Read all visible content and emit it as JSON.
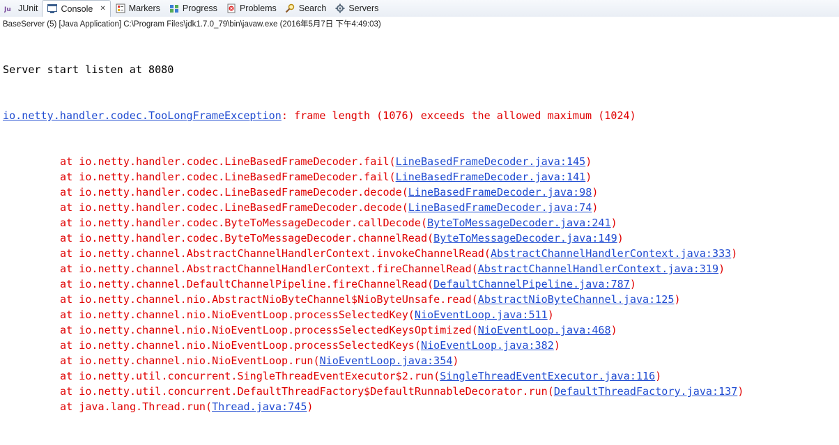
{
  "tabs": [
    {
      "label": "JUnit",
      "icon": "junit-icon"
    },
    {
      "label": "Console",
      "icon": "console-icon",
      "close": "✕"
    },
    {
      "label": "Markers",
      "icon": "markers-icon"
    },
    {
      "label": "Progress",
      "icon": "progress-icon"
    },
    {
      "label": "Problems",
      "icon": "problems-icon"
    },
    {
      "label": "Search",
      "icon": "search-icon"
    },
    {
      "label": "Servers",
      "icon": "servers-icon"
    }
  ],
  "info_line": "BaseServer (5) [Java Application] C:\\Program Files\\jdk1.7.0_79\\bin\\javaw.exe (2016年5月7日 下午4:49:03)",
  "console": {
    "first_line": "Server start listen at 8080",
    "exception": {
      "link": "io.netty.handler.codec.TooLongFrameException",
      "message": ": frame length (1076) exceeds the allowed maximum (1024)"
    },
    "stack": [
      {
        "method": "at io.netty.handler.codec.LineBasedFrameDecoder.fail(",
        "link": "LineBasedFrameDecoder.java:145"
      },
      {
        "method": "at io.netty.handler.codec.LineBasedFrameDecoder.fail(",
        "link": "LineBasedFrameDecoder.java:141"
      },
      {
        "method": "at io.netty.handler.codec.LineBasedFrameDecoder.decode(",
        "link": "LineBasedFrameDecoder.java:98"
      },
      {
        "method": "at io.netty.handler.codec.LineBasedFrameDecoder.decode(",
        "link": "LineBasedFrameDecoder.java:74"
      },
      {
        "method": "at io.netty.handler.codec.ByteToMessageDecoder.callDecode(",
        "link": "ByteToMessageDecoder.java:241"
      },
      {
        "method": "at io.netty.handler.codec.ByteToMessageDecoder.channelRead(",
        "link": "ByteToMessageDecoder.java:149"
      },
      {
        "method": "at io.netty.channel.AbstractChannelHandlerContext.invokeChannelRead(",
        "link": "AbstractChannelHandlerContext.java:333"
      },
      {
        "method": "at io.netty.channel.AbstractChannelHandlerContext.fireChannelRead(",
        "link": "AbstractChannelHandlerContext.java:319"
      },
      {
        "method": "at io.netty.channel.DefaultChannelPipeline.fireChannelRead(",
        "link": "DefaultChannelPipeline.java:787"
      },
      {
        "method": "at io.netty.channel.nio.AbstractNioByteChannel$NioByteUnsafe.read(",
        "link": "AbstractNioByteChannel.java:125"
      },
      {
        "method": "at io.netty.channel.nio.NioEventLoop.processSelectedKey(",
        "link": "NioEventLoop.java:511"
      },
      {
        "method": "at io.netty.channel.nio.NioEventLoop.processSelectedKeysOptimized(",
        "link": "NioEventLoop.java:468"
      },
      {
        "method": "at io.netty.channel.nio.NioEventLoop.processSelectedKeys(",
        "link": "NioEventLoop.java:382"
      },
      {
        "method": "at io.netty.channel.nio.NioEventLoop.run(",
        "link": "NioEventLoop.java:354"
      },
      {
        "method": "at io.netty.util.concurrent.SingleThreadEventExecutor$2.run(",
        "link": "SingleThreadEventExecutor.java:116"
      },
      {
        "method": "at io.netty.util.concurrent.DefaultThreadFactory$DefaultRunnableDecorator.run(",
        "link": "DefaultThreadFactory.java:137"
      },
      {
        "method": "at java.lang.Thread.run(",
        "link": "Thread.java:745"
      }
    ],
    "close_paren": ")"
  },
  "colors": {
    "error": "#e00000",
    "link": "#1f4bd1",
    "normal": "#000000"
  }
}
